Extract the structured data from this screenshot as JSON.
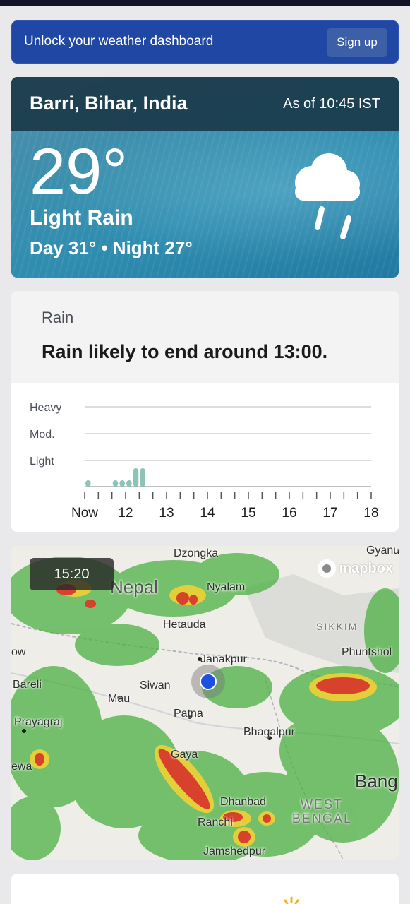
{
  "banner": {
    "text": "Unlock your weather dashboard",
    "signup_label": "Sign up"
  },
  "current": {
    "location": "Barri, Bihar, India",
    "as_of": "As of 10:45 IST",
    "temperature": "29°",
    "phrase": "Light Rain",
    "day_night": "Day 31° • Night 27°",
    "icon": "cloud-rain-icon"
  },
  "rain": {
    "label": "Rain",
    "summary": "Rain likely to end around 13:00.",
    "levels": [
      "Heavy",
      "Mod.",
      "Light"
    ],
    "ticks": [
      "Now",
      "12",
      "13",
      "14",
      "15",
      "16",
      "17",
      "18"
    ]
  },
  "chart_data": {
    "type": "bar",
    "title": "",
    "xlabel": "",
    "ylabel": "",
    "x_ticks": [
      "Now",
      "12",
      "13",
      "14",
      "15",
      "16",
      "17",
      "18"
    ],
    "y_levels": [
      "Light",
      "Mod.",
      "Heavy"
    ],
    "bar_color": "#8ec3b8",
    "series": [
      {
        "values": [
          0.22,
          0,
          0,
          0,
          0.22,
          0.22,
          0.22,
          0.7,
          0.7,
          0,
          0,
          0,
          0,
          0,
          0,
          0,
          0,
          0,
          0,
          0,
          0,
          0,
          0,
          0,
          0,
          0,
          0,
          0,
          0,
          0,
          0,
          0,
          0,
          0,
          0,
          0,
          0,
          0,
          0,
          0,
          0,
          0
        ]
      }
    ]
  },
  "map": {
    "time": "15:20",
    "attribution": "mapbox",
    "places": [
      "Dzongka",
      "Gyanu",
      "Nyalam",
      "Nepal",
      "Hetauda",
      "SIKKIM",
      "Phuntshol",
      "Janakpur",
      "Bareli",
      "Siwan",
      "Mau",
      "Patna",
      "Prayagraj",
      "Bhagalpur",
      "Gaya",
      "Bang",
      "Dhanbad",
      "WEST",
      "BENGAL",
      "Ranchi",
      "Jamshedpur",
      "ewa",
      "ow"
    ],
    "colors": {
      "light": "#58b84e",
      "moderate": "#e8d23a",
      "heavy": "#d7402b"
    }
  }
}
